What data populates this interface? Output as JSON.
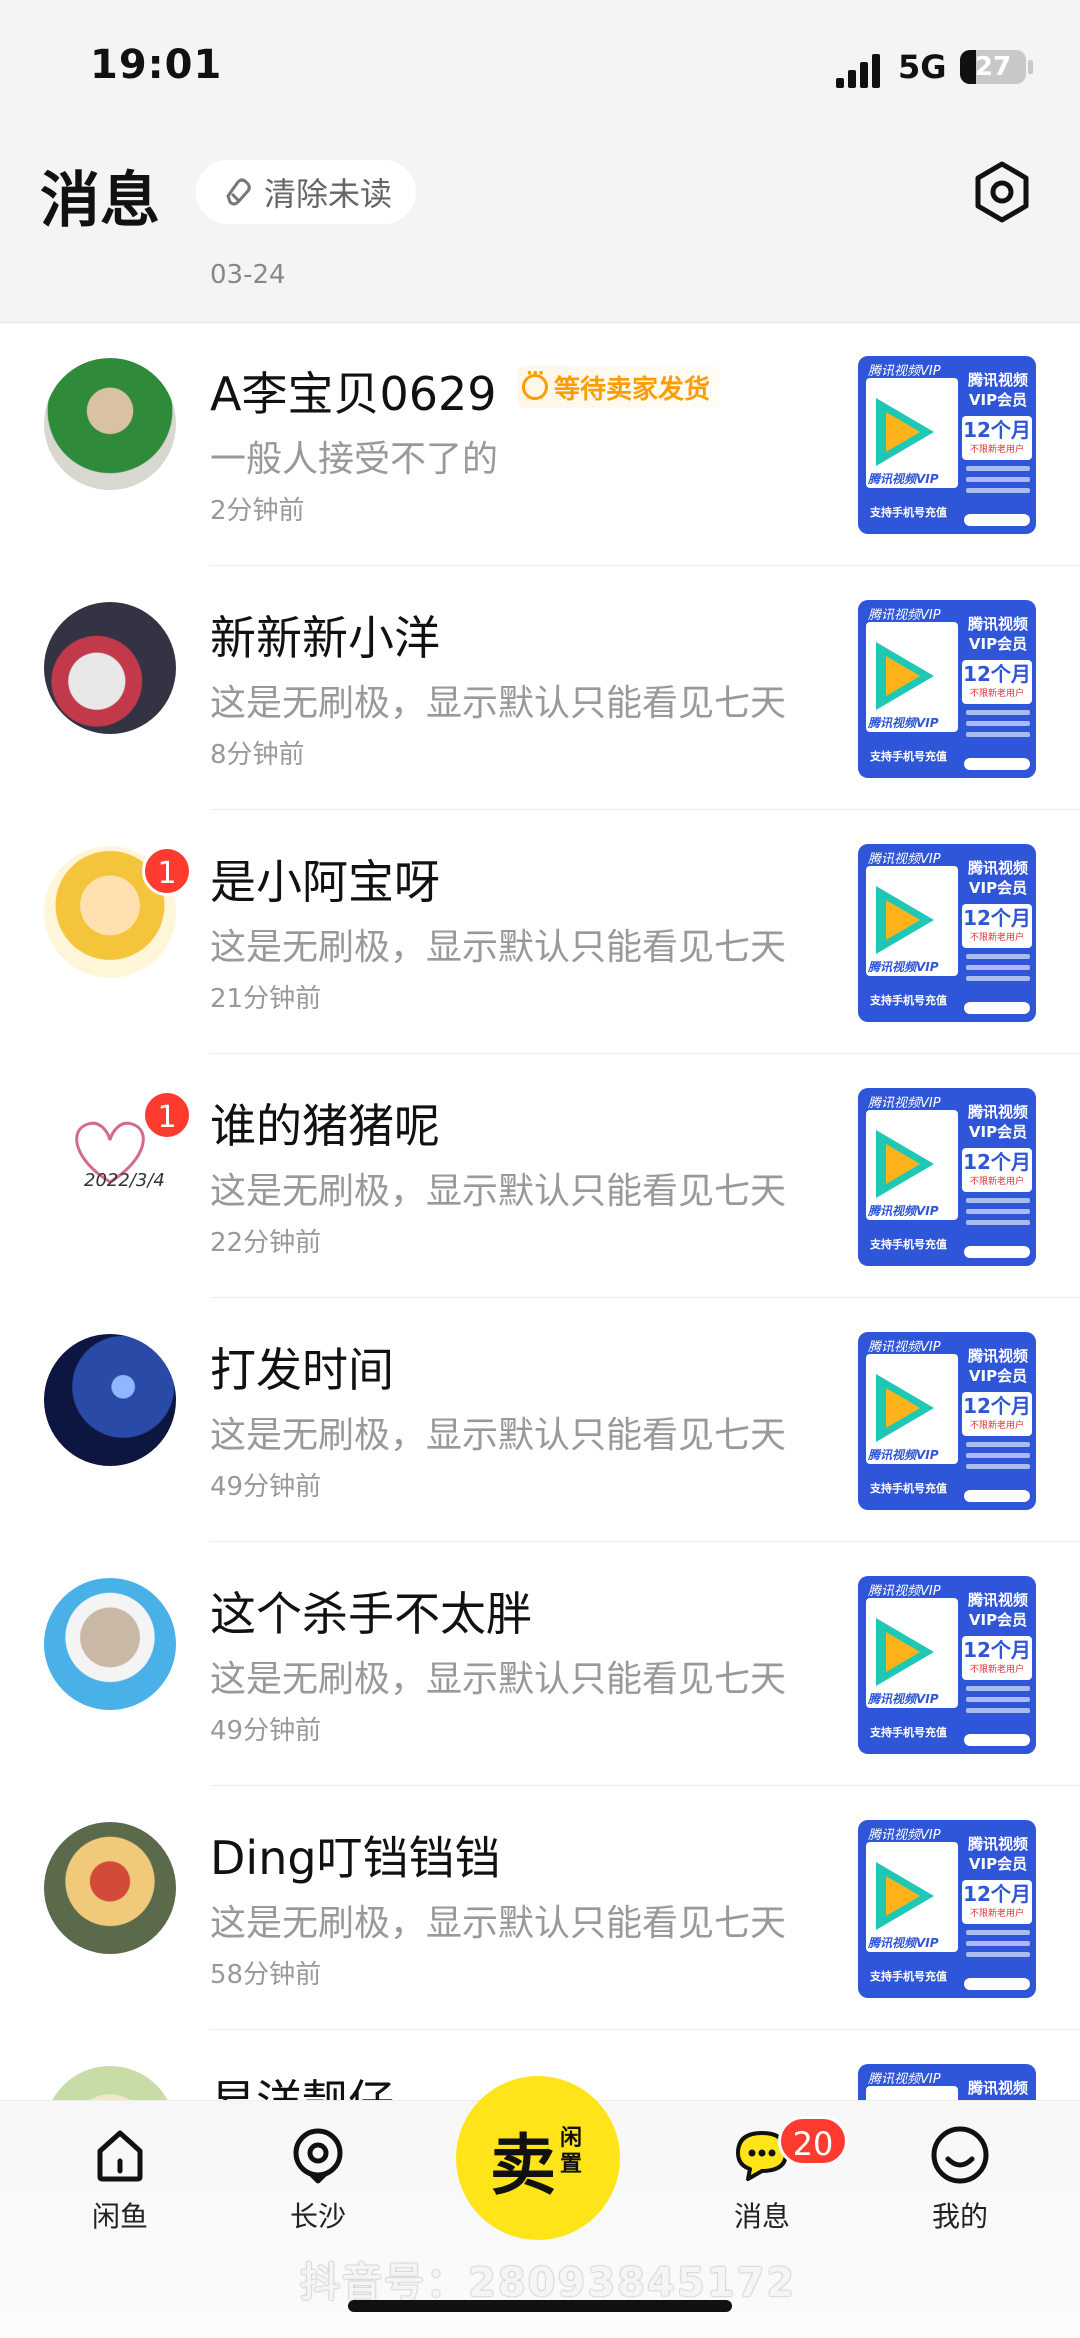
{
  "status_bar": {
    "time": "19:01",
    "network": "5G",
    "battery": "27"
  },
  "header": {
    "title": "消息",
    "clear_unread": "清除未读",
    "date": "03-24"
  },
  "thumbnail": {
    "top_left": "腾讯视频VIP",
    "top_right_1": "腾讯视频",
    "top_right_2": "VIP会员",
    "months": "12个月",
    "new_old": "不限新老用户",
    "vip": "腾讯视频VIP",
    "support": "支持手机号充值"
  },
  "conversations": [
    {
      "name": "A李宝贝0629",
      "status": "等待卖家发货",
      "message": "一般人接受不了的",
      "time": "2分钟前",
      "badge": ""
    },
    {
      "name": "新新新小洋",
      "status": "",
      "message": "这是无刷极，显示默认只能看见七天",
      "time": "8分钟前",
      "badge": ""
    },
    {
      "name": "是小阿宝呀",
      "status": "",
      "message": "这是无刷极，显示默认只能看见七天",
      "time": "21分钟前",
      "badge": "1"
    },
    {
      "name": "谁的猪猪呢",
      "status": "",
      "message": "这是无刷极，显示默认只能看见七天",
      "time": "22分钟前",
      "badge": "1"
    },
    {
      "name": "打发时间",
      "status": "",
      "message": "这是无刷极，显示默认只能看见七天",
      "time": "49分钟前",
      "badge": ""
    },
    {
      "name": "这个杀手不太胖",
      "status": "",
      "message": "这是无刷极，显示默认只能看见七天",
      "time": "49分钟前",
      "badge": ""
    },
    {
      "name": "Ding叮铛铛铛",
      "status": "",
      "message": "这是无刷极，显示默认只能看见七天",
      "time": "58分钟前",
      "badge": ""
    },
    {
      "name": "易洋靓仔",
      "status": "",
      "message": "",
      "time": "",
      "badge": ""
    }
  ],
  "avatar_text": {
    "heart_date": "2022/3/4"
  },
  "tabbar": {
    "home": "闲鱼",
    "location": "长沙",
    "sell_big": "卖",
    "sell_small": "闲置",
    "messages": "消息",
    "messages_badge": "20",
    "mine": "我的"
  },
  "watermark": "抖音号：28093845172",
  "colors": {
    "accent": "#ffe41a",
    "badge": "#ff3b30",
    "status": "#ff9d00",
    "thumb_bg": "#2f56d8"
  }
}
